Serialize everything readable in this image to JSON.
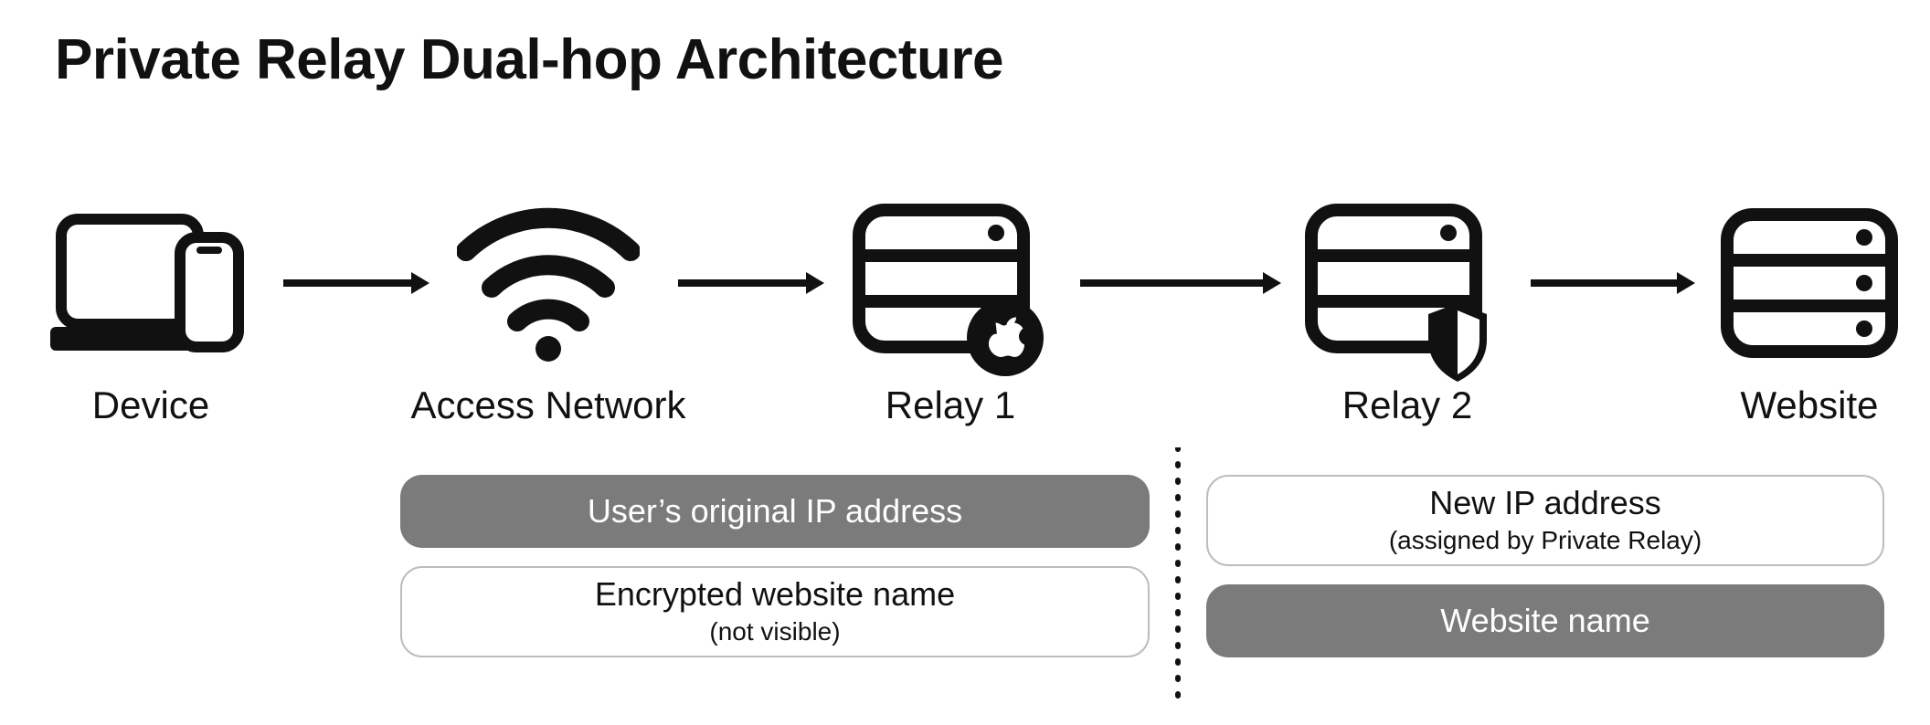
{
  "title": "Private Relay Dual-hop Architecture",
  "nodes": {
    "device": "Device",
    "access_network": "Access Network",
    "relay1": "Relay 1",
    "relay2": "Relay 2",
    "website": "Website"
  },
  "left_panel": {
    "top": {
      "main": "User’s original IP address"
    },
    "bottom": {
      "main": "Encrypted website name",
      "sub": "(not visible)"
    }
  },
  "right_panel": {
    "top": {
      "main": "New IP address",
      "sub": "(assigned by Private Relay)"
    },
    "bottom": {
      "main": "Website name"
    }
  }
}
